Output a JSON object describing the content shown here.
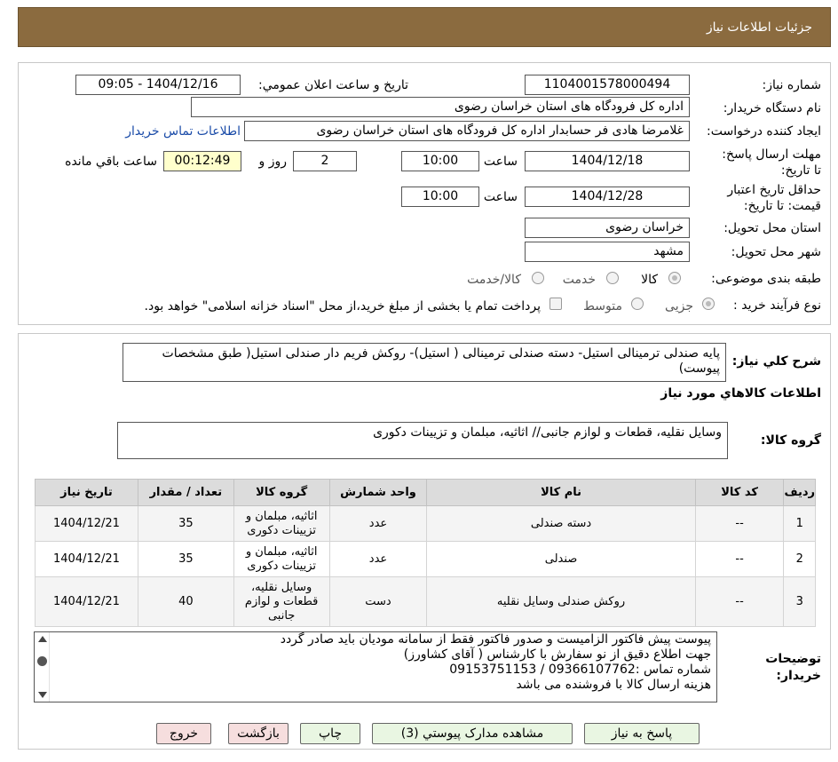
{
  "header": {
    "title": "جزئیات اطلاعات نیاز"
  },
  "form": {
    "need_number_label": "شماره نیاز:",
    "need_number": "1104001578000494",
    "announce_label": "تاریخ و ساعت اعلان عمومي:",
    "announce_value": "1404/12/16 - 09:05",
    "buyer_org_label": "نام دستگاه خريدار:",
    "buyer_org": "اداره کل فرودگاه های استان خراسان رضوی",
    "requester_label": "ایجاد کننده درخواست:",
    "requester": "غلامرضا هادی فر حسابدار اداره کل فرودگاه های استان خراسان رضوی",
    "contact_link": "اطلاعات تماس خریدار",
    "deadline_label": "مهلت ارسال پاسخ: تا تاریخ:",
    "deadline_date": "1404/12/18",
    "time_label": "ساعت",
    "deadline_time": "10:00",
    "days_value": "2",
    "days_label": "روز و",
    "countdown": "00:12:49",
    "remaining_label": "ساعت باقي مانده",
    "validity_label": "حداقل تاریخ اعتبار قیمت: تا تاریخ:",
    "validity_date": "1404/12/28",
    "validity_time": "10:00",
    "province_label": "استان محل تحویل:",
    "province": "خراسان رضوی",
    "city_label": "شهر محل تحویل:",
    "city": "مشهد",
    "category_label": "طبقه بندی موضوعی:",
    "category_options": [
      "کالا",
      "خدمت",
      "کالا/خدمت"
    ],
    "process_label": "نوع فرآیند خرید :",
    "process_options": [
      "جزیی",
      "متوسط"
    ],
    "payment_note": "پرداخت تمام یا بخشی از مبلغ خرید،از محل \"اسناد خزانه اسلامی\" خواهد بود."
  },
  "description": {
    "label": "شرح کلي نياز:",
    "text": "پایه صندلی ترمینالی استیل- دسته صندلی ترمینالی ( استیل)- روکش فریم دار صندلی استیل( طبق مشخصات پیوست)"
  },
  "goods_info_title": "اطلاعات کالاهاي مورد نياز",
  "goods_group": {
    "label": "گروه کالا:",
    "text": "وسایل نقلیه، قطعات و لوازم جانبی// اثاثیه، مبلمان و تزیینات دکوری"
  },
  "table": {
    "headers": [
      "رديف",
      "کد کالا",
      "نام کالا",
      "واحد شمارش",
      "گروه کالا",
      "تعداد / مقدار",
      "تاريخ نياز"
    ],
    "rows": [
      {
        "row": "1",
        "code": "--",
        "name": "دسته صندلی",
        "unit": "عدد",
        "group_lines": [
          "اثاثیه، مبلمان و",
          "تزیینات دکوری"
        ],
        "qty": "35",
        "date": "1404/12/21"
      },
      {
        "row": "2",
        "code": "--",
        "name": "صندلی",
        "unit": "عدد",
        "group_lines": [
          "اثاثیه، مبلمان و",
          "تزیینات دکوری"
        ],
        "qty": "35",
        "date": "1404/12/21"
      },
      {
        "row": "3",
        "code": "--",
        "name": "روکش صندلی وسایل نقلیه",
        "unit": "دست",
        "group_lines": [
          "وسایل نقلیه،",
          "قطعات و لوازم",
          "جانبی"
        ],
        "qty": "40",
        "date": "1404/12/21"
      }
    ]
  },
  "notes": {
    "label": "توضيحات خريدار:",
    "lines": [
      "پیوست پیش فاکتور الزامیست و صدور فاکتور فقط از سامانه مودیان باید صادر گردد",
      "جهت اطلاع دقیق از نو سفارش با کارشناس   ( آقای کشاورز)",
      "شماره تماس :09366107762    /    09153751153",
      "هزینه ارسال کالا با فروشنده می باشد"
    ]
  },
  "buttons": {
    "reply": "پاسخ به نياز",
    "attachments": "مشاهده مدارک پيوستي (3)",
    "print": "چاپ",
    "back": "بازگشت",
    "exit": "خروج"
  },
  "colors": {
    "header_bg": "#8b6b3f",
    "button_green": "#e9f6e2",
    "button_pink": "#f6dede",
    "countdown_bg": "#ffffcc"
  }
}
